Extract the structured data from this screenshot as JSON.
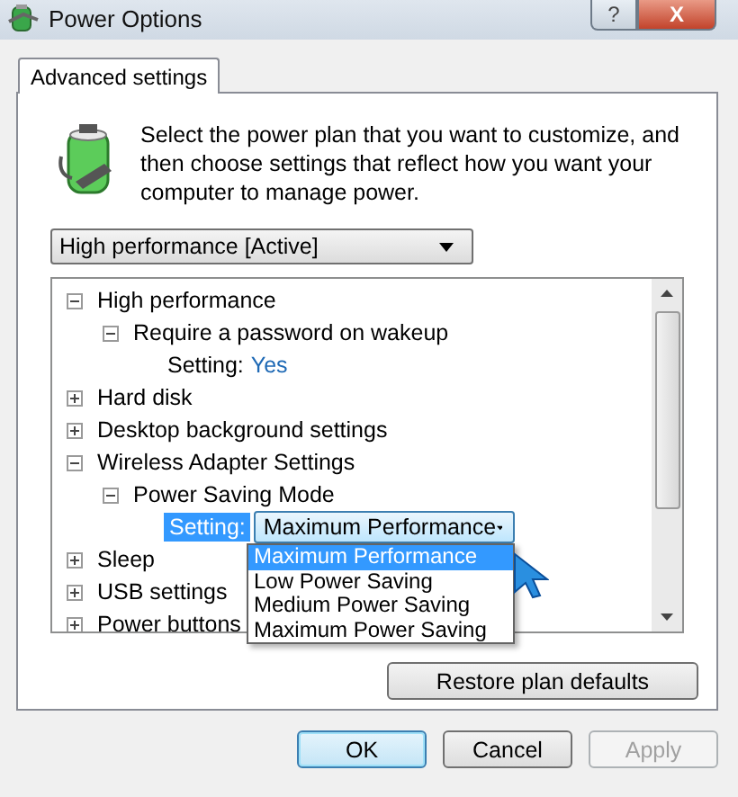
{
  "window": {
    "title": "Power Options",
    "help_button": "?",
    "close_button": "X"
  },
  "tabs": [
    {
      "label": "Advanced settings",
      "selected": true
    }
  ],
  "description": "Select the power plan that you want to customize, and then choose settings that reflect how you want your computer to manage power.",
  "plan_dropdown": {
    "value": "High performance [Active]"
  },
  "tree": [
    {
      "kind": "group",
      "label": "High performance",
      "expanded": true,
      "children": [
        {
          "kind": "group",
          "label": "Require a password on wakeup",
          "expanded": true,
          "children": [
            {
              "kind": "setting",
              "label": "Setting:",
              "value": "Yes"
            }
          ]
        }
      ]
    },
    {
      "kind": "group",
      "label": "Hard disk",
      "expanded": false
    },
    {
      "kind": "group",
      "label": "Desktop background settings",
      "expanded": false
    },
    {
      "kind": "group",
      "label": "Wireless Adapter Settings",
      "expanded": true,
      "children": [
        {
          "kind": "group",
          "label": "Power Saving Mode",
          "expanded": true,
          "children": [
            {
              "kind": "select",
              "label": "Setting:",
              "value": "Maximum Performance",
              "selected": true
            }
          ]
        }
      ]
    },
    {
      "kind": "group",
      "label": "Sleep",
      "expanded": false
    },
    {
      "kind": "group",
      "label": "USB settings",
      "expanded": false
    },
    {
      "kind": "group",
      "label": "Power buttons",
      "expanded": false
    }
  ],
  "dropdown_list": {
    "options": [
      {
        "label": "Maximum Performance",
        "selected": true
      },
      {
        "label": "Low Power Saving",
        "selected": false
      },
      {
        "label": "Medium Power Saving",
        "selected": false
      },
      {
        "label": "Maximum Power Saving",
        "selected": false
      }
    ]
  },
  "restore_button": "Restore plan defaults",
  "buttons": [
    {
      "label": "OK",
      "default": true,
      "disabled": false
    },
    {
      "label": "Cancel",
      "default": false,
      "disabled": false
    },
    {
      "label": "Apply",
      "default": false,
      "disabled": true
    }
  ]
}
